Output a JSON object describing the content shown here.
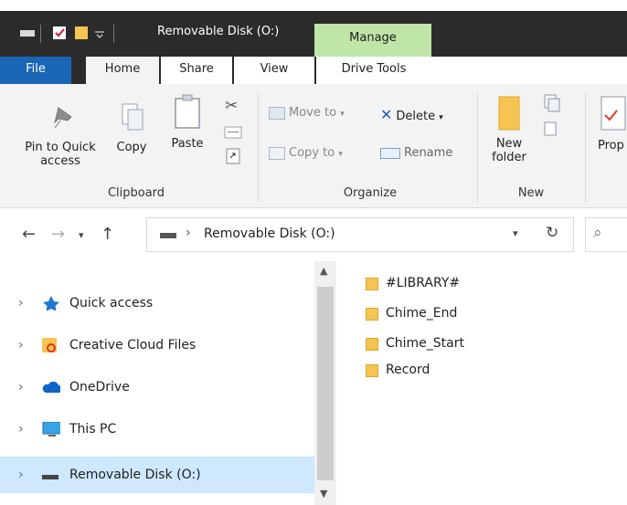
{
  "window": {
    "title": "Removable Disk (O:)",
    "contextual_tab": "Manage"
  },
  "tabs": {
    "file": "File",
    "home": "Home",
    "share": "Share",
    "view": "View",
    "drive_tools": "Drive Tools"
  },
  "ribbon": {
    "clipboard": {
      "pin_label_line1": "Pin to Quick",
      "pin_label_line2": "access",
      "copy": "Copy",
      "paste": "Paste",
      "group": "Clipboard"
    },
    "organize": {
      "move_to": "Move to",
      "copy_to": "Copy to",
      "delete": "Delete",
      "rename": "Rename",
      "group": "Organize"
    },
    "new": {
      "new_folder_line1": "New",
      "new_folder_line2": "folder",
      "group": "New"
    },
    "open": {
      "properties_partial": "Prop"
    }
  },
  "address": {
    "path_segment": "Removable Disk (O:)"
  },
  "nav_pane": {
    "items": [
      {
        "label": "Quick access",
        "icon": "star-icon"
      },
      {
        "label": "Creative Cloud Files",
        "icon": "creative-cloud-icon"
      },
      {
        "label": "OneDrive",
        "icon": "cloud-icon"
      },
      {
        "label": "This PC",
        "icon": "monitor-icon"
      },
      {
        "label": "Removable Disk (O:)",
        "icon": "drive-icon",
        "selected": true
      }
    ]
  },
  "files": [
    {
      "name": "#LIBRARY#"
    },
    {
      "name": "Chime_End"
    },
    {
      "name": "Chime_Start"
    },
    {
      "name": "Record"
    }
  ],
  "colors": {
    "titlebar": "#2b2b2b",
    "manage_tab": "#bfe6a8",
    "file_tab": "#1a66b6",
    "selected": "#cde8ff",
    "folder": "#f6c451"
  }
}
